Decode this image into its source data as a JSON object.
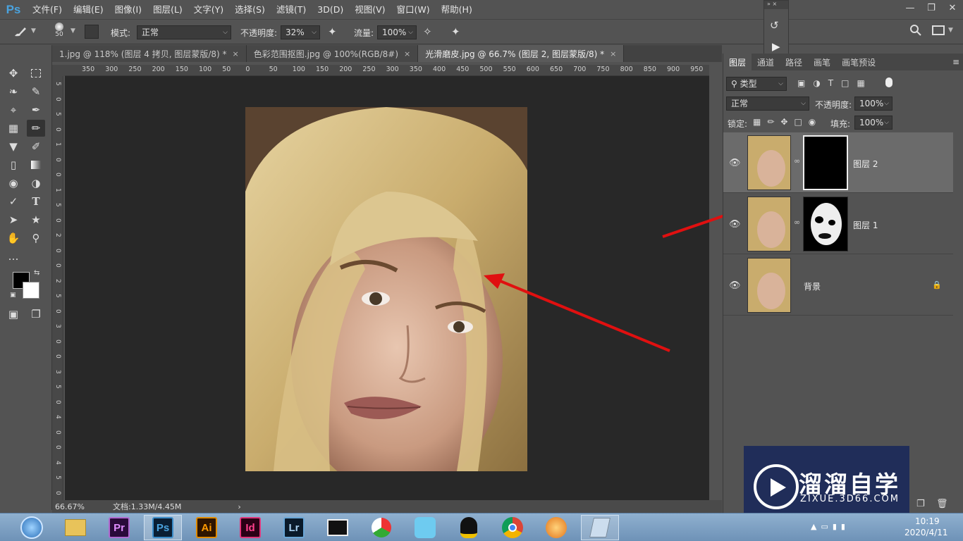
{
  "app": {
    "logo": "Ps"
  },
  "menu": [
    "文件(F)",
    "编辑(E)",
    "图像(I)",
    "图层(L)",
    "文字(Y)",
    "选择(S)",
    "滤镜(T)",
    "3D(D)",
    "视图(V)",
    "窗口(W)",
    "帮助(H)"
  ],
  "options": {
    "brush_size": "50",
    "mode_label": "模式:",
    "mode_value": "正常",
    "opacity_label": "不透明度:",
    "opacity_value": "32%",
    "flow_label": "流量:",
    "flow_value": "100%"
  },
  "tabs": [
    {
      "label": "1.jpg @ 118% (图层 4 拷贝, 图层蒙版/8) *"
    },
    {
      "label": "色彩范围抠图.jpg @ 100%(RGB/8#)"
    },
    {
      "label": "光滑磨皮.jpg @ 66.7% (图层 2, 图层蒙版/8) *"
    }
  ],
  "ruler_h": [
    "350",
    "300",
    "250",
    "200",
    "150",
    "100",
    "50",
    "0",
    "50",
    "100",
    "150",
    "200",
    "250",
    "300",
    "350",
    "400",
    "450",
    "500",
    "550",
    "600",
    "650",
    "700",
    "750",
    "800",
    "850",
    "900",
    "950"
  ],
  "ruler_v": [
    "5",
    "0",
    "5",
    "0",
    "1",
    "0",
    "0",
    "1",
    "5",
    "0",
    "2",
    "0",
    "0",
    "2",
    "5",
    "0",
    "3",
    "0",
    "0",
    "3",
    "5",
    "0",
    "4",
    "0",
    "0",
    "4",
    "5",
    "0"
  ],
  "status": {
    "zoom": "66.67%",
    "doc": "文档:1.33M/4.45M"
  },
  "panels": {
    "tabs": [
      "图层",
      "通道",
      "路径",
      "画笔",
      "画笔预设"
    ],
    "filter_kind": "类型",
    "blend_mode": "正常",
    "opacity_label": "不透明度:",
    "opacity_value": "100%",
    "lock_label": "锁定:",
    "fill_label": "填充:",
    "fill_value": "100%",
    "layers": [
      {
        "name": "图层 2"
      },
      {
        "name": "图层 1"
      },
      {
        "name": "背景"
      }
    ]
  },
  "watermark": {
    "brand": "溜溜自学",
    "url": "ZIXUE.3D66.COM"
  },
  "taskbar": {
    "apps": [
      "Pr",
      "Ps",
      "Ai",
      "Id",
      "Lr"
    ],
    "time": "10:19",
    "date": "2020/4/11"
  },
  "colors": {
    "accent": "#4aa3df",
    "annotation": "#e01010"
  }
}
